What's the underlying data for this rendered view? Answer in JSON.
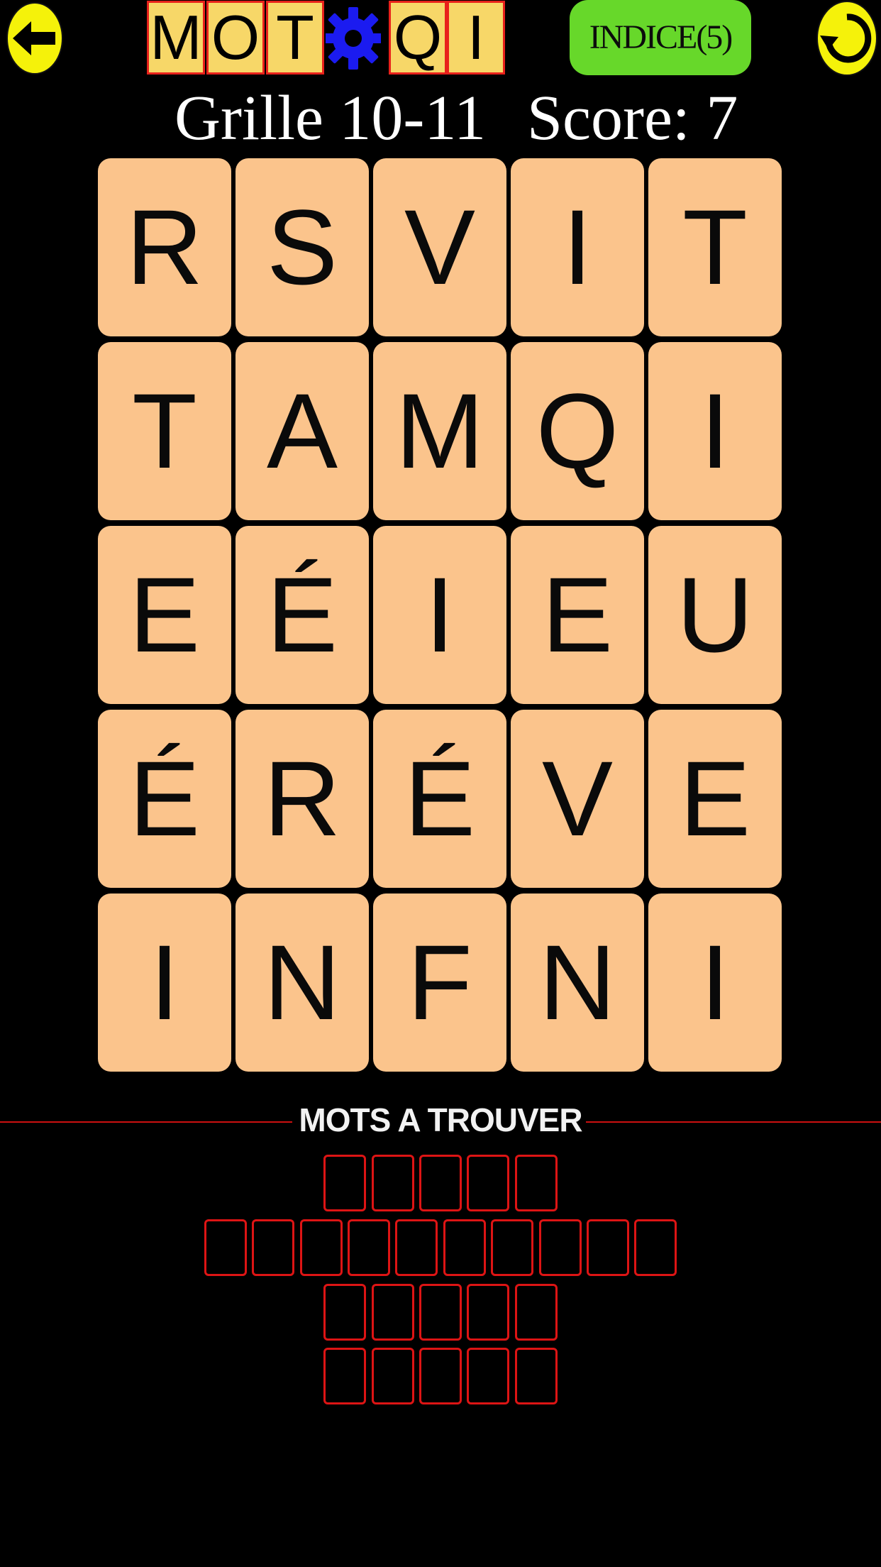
{
  "logo": {
    "letters_left": [
      "M",
      "O",
      "T"
    ],
    "letters_right": [
      "Q",
      "I"
    ],
    "tile_color": "#f7d768",
    "border_color": "#e8211b",
    "gear_color": "#1b1bf0"
  },
  "toolbar": {
    "back_icon": "arrow-left-icon",
    "hint_label": "INDICE(5)",
    "refresh_icon": "refresh-icon",
    "icon_color": "#f5f20a",
    "hint_color": "#67d82a"
  },
  "header": {
    "grid_label": "Grille 10-11",
    "score_label": "Score: 7"
  },
  "board": {
    "tile_color": "#fbc48c",
    "rows": [
      [
        "R",
        "S",
        "V",
        "I",
        "T"
      ],
      [
        "T",
        "A",
        "M",
        "Q",
        "I"
      ],
      [
        "E",
        "É",
        "I",
        "E",
        "U"
      ],
      [
        "É",
        "R",
        "É",
        "V",
        "E"
      ],
      [
        "I",
        "N",
        "F",
        "N",
        "I"
      ]
    ]
  },
  "words": {
    "title": "MOTS A TROUVER",
    "box_color": "#dd1414",
    "lengths": [
      5,
      10,
      5,
      5
    ]
  }
}
